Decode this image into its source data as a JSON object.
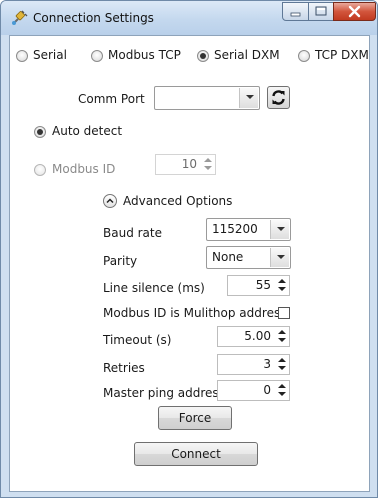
{
  "window": {
    "title": "Connection Settings",
    "icons": {
      "app": "plug-icon",
      "minimize": "minimize-icon",
      "maximize": "maximize-icon",
      "close": "close-icon"
    }
  },
  "protocol": {
    "options": [
      {
        "label": "Serial",
        "checked": false
      },
      {
        "label": "Modbus TCP",
        "checked": false
      },
      {
        "label": "Serial DXM",
        "checked": true
      },
      {
        "label": "TCP DXM",
        "checked": false
      }
    ]
  },
  "comm_port": {
    "label": "Comm Port",
    "value": "",
    "refresh_icon": "refresh-icon"
  },
  "auto_detect": {
    "label": "Auto detect",
    "checked": true
  },
  "modbus_id": {
    "label": "Modbus ID",
    "value": "10",
    "enabled": false
  },
  "advanced": {
    "toggle_label": "Advanced Options",
    "toggle_icon": "chevron-up-icon",
    "baud_rate": {
      "label": "Baud rate",
      "value": "115200"
    },
    "parity": {
      "label": "Parity",
      "value": "None"
    },
    "line_silence": {
      "label": "Line silence (ms)",
      "value": "55"
    },
    "multihop": {
      "label": "Modbus ID is Mulithop address",
      "checked": false
    },
    "timeout": {
      "label": "Timeout (s)",
      "value": "5.00"
    },
    "retries": {
      "label": "Retries",
      "value": "3"
    },
    "master_ping": {
      "label": "Master ping address",
      "value": "0"
    },
    "force_label": "Force"
  },
  "connect_label": "Connect",
  "colors": {
    "title_bar": "#c4d8ee",
    "close_button": "#c8452b",
    "frame": "#cfdff0"
  }
}
